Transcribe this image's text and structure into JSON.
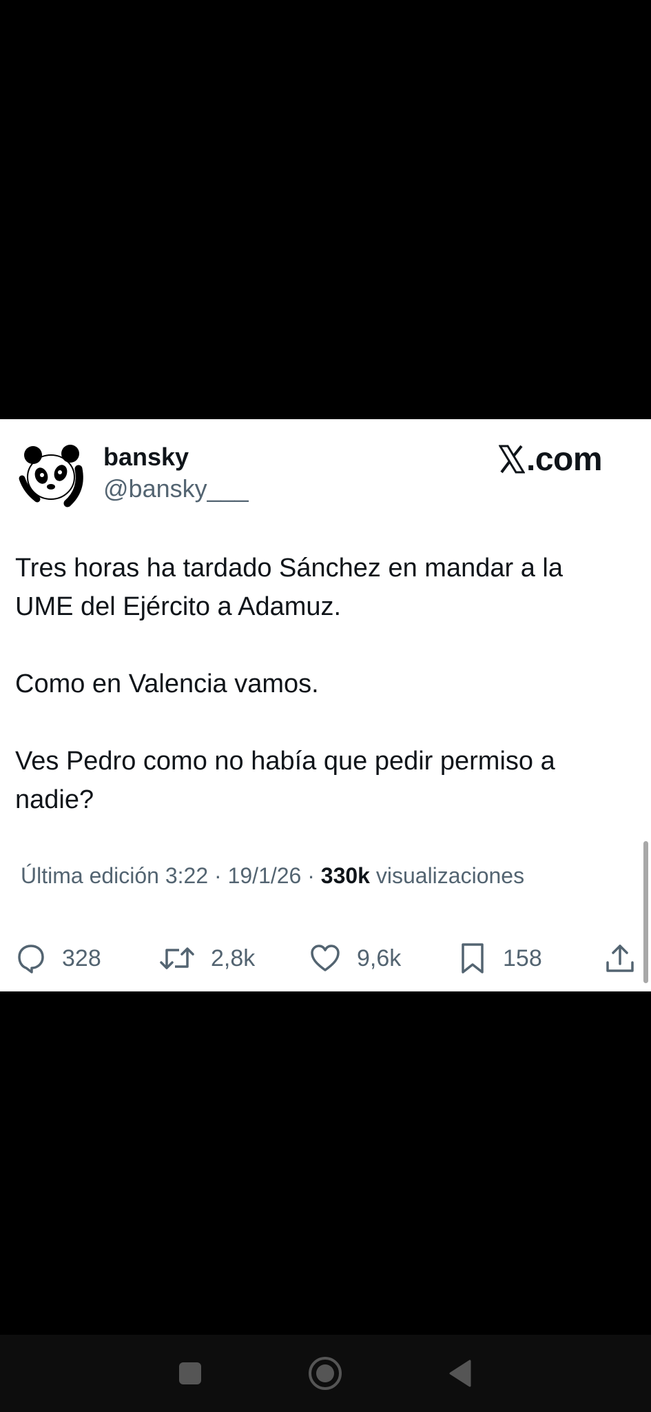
{
  "tweet": {
    "display_name": "bansky",
    "handle": "@bansky___",
    "brand": ".com",
    "text": [
      "Tres horas ha tardado Sánchez en mandar a la UME del Ejército a Adamuz.",
      "Como en Valencia vamos.",
      "Ves Pedro como no había que pedir permiso a nadie?"
    ],
    "meta": {
      "edited_label": "Última edición 3:22 · 19/1/26",
      "separator": " · ",
      "views_count": "330k",
      "views_label": "visualizaciones"
    },
    "actions": {
      "replies": "328",
      "reposts": "2,8k",
      "likes": "9,6k",
      "bookmarks": "158"
    }
  },
  "icons": {
    "avatar": "panda-icon",
    "brand": "x-logo-icon",
    "reply": "reply-icon",
    "repost": "repost-icon",
    "like": "heart-icon",
    "bookmark": "bookmark-icon",
    "share": "share-icon",
    "nav_recents": "square-icon",
    "nav_home": "circle-icon",
    "nav_back": "triangle-back-icon"
  },
  "colors": {
    "text_primary": "#0f1419",
    "text_secondary": "#536471",
    "card_background": "#ffffff",
    "page_background": "#000000",
    "nav_icon": "#555555"
  }
}
